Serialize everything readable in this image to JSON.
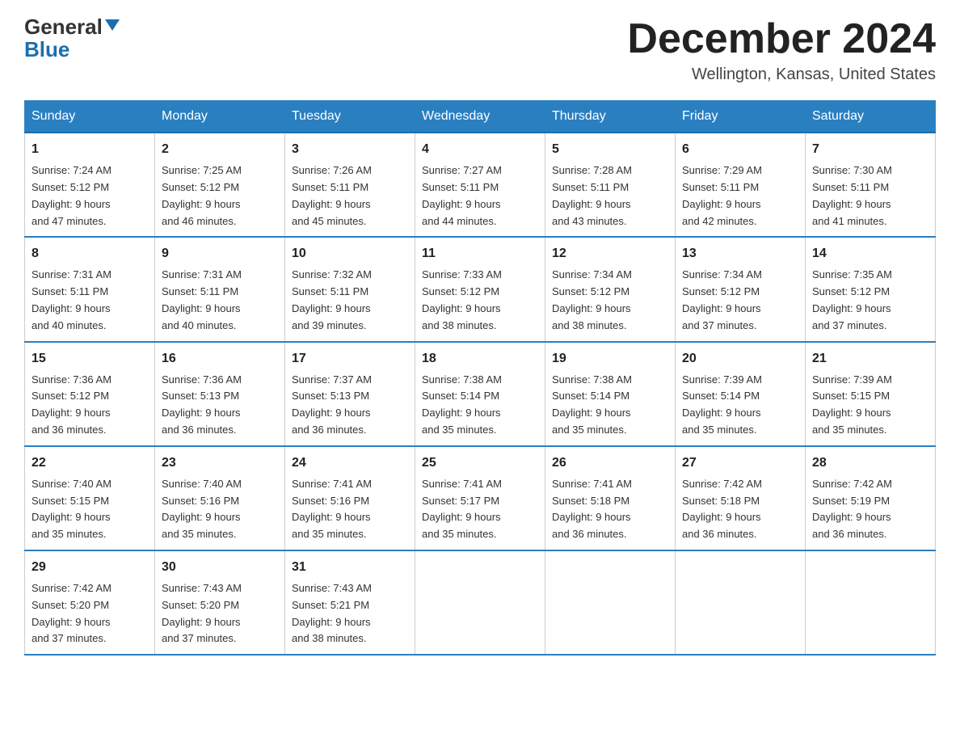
{
  "header": {
    "logo_general": "General",
    "logo_blue": "Blue",
    "month_title": "December 2024",
    "location": "Wellington, Kansas, United States"
  },
  "days_of_week": [
    "Sunday",
    "Monday",
    "Tuesday",
    "Wednesday",
    "Thursday",
    "Friday",
    "Saturday"
  ],
  "weeks": [
    [
      {
        "num": "1",
        "sunrise": "7:24 AM",
        "sunset": "5:12 PM",
        "daylight": "9 hours and 47 minutes."
      },
      {
        "num": "2",
        "sunrise": "7:25 AM",
        "sunset": "5:12 PM",
        "daylight": "9 hours and 46 minutes."
      },
      {
        "num": "3",
        "sunrise": "7:26 AM",
        "sunset": "5:11 PM",
        "daylight": "9 hours and 45 minutes."
      },
      {
        "num": "4",
        "sunrise": "7:27 AM",
        "sunset": "5:11 PM",
        "daylight": "9 hours and 44 minutes."
      },
      {
        "num": "5",
        "sunrise": "7:28 AM",
        "sunset": "5:11 PM",
        "daylight": "9 hours and 43 minutes."
      },
      {
        "num": "6",
        "sunrise": "7:29 AM",
        "sunset": "5:11 PM",
        "daylight": "9 hours and 42 minutes."
      },
      {
        "num": "7",
        "sunrise": "7:30 AM",
        "sunset": "5:11 PM",
        "daylight": "9 hours and 41 minutes."
      }
    ],
    [
      {
        "num": "8",
        "sunrise": "7:31 AM",
        "sunset": "5:11 PM",
        "daylight": "9 hours and 40 minutes."
      },
      {
        "num": "9",
        "sunrise": "7:31 AM",
        "sunset": "5:11 PM",
        "daylight": "9 hours and 40 minutes."
      },
      {
        "num": "10",
        "sunrise": "7:32 AM",
        "sunset": "5:11 PM",
        "daylight": "9 hours and 39 minutes."
      },
      {
        "num": "11",
        "sunrise": "7:33 AM",
        "sunset": "5:12 PM",
        "daylight": "9 hours and 38 minutes."
      },
      {
        "num": "12",
        "sunrise": "7:34 AM",
        "sunset": "5:12 PM",
        "daylight": "9 hours and 38 minutes."
      },
      {
        "num": "13",
        "sunrise": "7:34 AM",
        "sunset": "5:12 PM",
        "daylight": "9 hours and 37 minutes."
      },
      {
        "num": "14",
        "sunrise": "7:35 AM",
        "sunset": "5:12 PM",
        "daylight": "9 hours and 37 minutes."
      }
    ],
    [
      {
        "num": "15",
        "sunrise": "7:36 AM",
        "sunset": "5:12 PM",
        "daylight": "9 hours and 36 minutes."
      },
      {
        "num": "16",
        "sunrise": "7:36 AM",
        "sunset": "5:13 PM",
        "daylight": "9 hours and 36 minutes."
      },
      {
        "num": "17",
        "sunrise": "7:37 AM",
        "sunset": "5:13 PM",
        "daylight": "9 hours and 36 minutes."
      },
      {
        "num": "18",
        "sunrise": "7:38 AM",
        "sunset": "5:14 PM",
        "daylight": "9 hours and 35 minutes."
      },
      {
        "num": "19",
        "sunrise": "7:38 AM",
        "sunset": "5:14 PM",
        "daylight": "9 hours and 35 minutes."
      },
      {
        "num": "20",
        "sunrise": "7:39 AM",
        "sunset": "5:14 PM",
        "daylight": "9 hours and 35 minutes."
      },
      {
        "num": "21",
        "sunrise": "7:39 AM",
        "sunset": "5:15 PM",
        "daylight": "9 hours and 35 minutes."
      }
    ],
    [
      {
        "num": "22",
        "sunrise": "7:40 AM",
        "sunset": "5:15 PM",
        "daylight": "9 hours and 35 minutes."
      },
      {
        "num": "23",
        "sunrise": "7:40 AM",
        "sunset": "5:16 PM",
        "daylight": "9 hours and 35 minutes."
      },
      {
        "num": "24",
        "sunrise": "7:41 AM",
        "sunset": "5:16 PM",
        "daylight": "9 hours and 35 minutes."
      },
      {
        "num": "25",
        "sunrise": "7:41 AM",
        "sunset": "5:17 PM",
        "daylight": "9 hours and 35 minutes."
      },
      {
        "num": "26",
        "sunrise": "7:41 AM",
        "sunset": "5:18 PM",
        "daylight": "9 hours and 36 minutes."
      },
      {
        "num": "27",
        "sunrise": "7:42 AM",
        "sunset": "5:18 PM",
        "daylight": "9 hours and 36 minutes."
      },
      {
        "num": "28",
        "sunrise": "7:42 AM",
        "sunset": "5:19 PM",
        "daylight": "9 hours and 36 minutes."
      }
    ],
    [
      {
        "num": "29",
        "sunrise": "7:42 AM",
        "sunset": "5:20 PM",
        "daylight": "9 hours and 37 minutes."
      },
      {
        "num": "30",
        "sunrise": "7:43 AM",
        "sunset": "5:20 PM",
        "daylight": "9 hours and 37 minutes."
      },
      {
        "num": "31",
        "sunrise": "7:43 AM",
        "sunset": "5:21 PM",
        "daylight": "9 hours and 38 minutes."
      },
      null,
      null,
      null,
      null
    ]
  ],
  "labels": {
    "sunrise": "Sunrise:",
    "sunset": "Sunset:",
    "daylight": "Daylight:"
  }
}
